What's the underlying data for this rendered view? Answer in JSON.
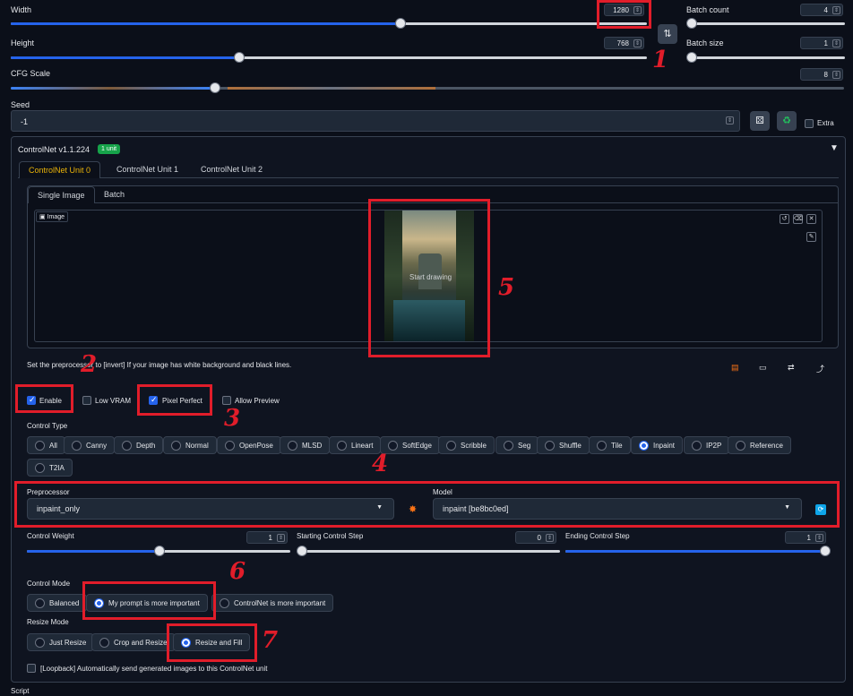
{
  "generation": {
    "width": {
      "label": "Width",
      "value": "1280"
    },
    "height": {
      "label": "Height",
      "value": "768"
    },
    "swap_icon": "swap-arrows-icon",
    "batch_count": {
      "label": "Batch count",
      "value": "4"
    },
    "batch_size": {
      "label": "Batch size",
      "value": "1"
    },
    "cfg_scale": {
      "label": "CFG Scale",
      "value": "8"
    },
    "seed": {
      "label": "Seed",
      "value": "-1",
      "extra_label": "Extra"
    }
  },
  "controlnet": {
    "title": "ControlNet v1.1.224",
    "badge": "1 unit",
    "collapse_glyph": "▼",
    "unit_tabs": [
      "ControlNet Unit 0",
      "ControlNet Unit 1",
      "ControlNet Unit 2"
    ],
    "image_tabs": [
      "Single Image",
      "Batch"
    ],
    "image_label": "Image",
    "image_overlay_text": "Start drawing",
    "hint_text": "Set the preprocessor to [invert] If your image has white background and black lines.",
    "checkboxes": [
      {
        "label": "Enable",
        "checked": true
      },
      {
        "label": "Low VRAM",
        "checked": false
      },
      {
        "label": "Pixel Perfect",
        "checked": true
      },
      {
        "label": "Allow Preview",
        "checked": false
      }
    ],
    "control_type_label": "Control Type",
    "control_types": [
      "All",
      "Canny",
      "Depth",
      "Normal",
      "OpenPose",
      "MLSD",
      "Lineart",
      "SoftEdge",
      "Scribble",
      "Seg",
      "Shuffle",
      "Tile",
      "Inpaint",
      "IP2P",
      "Reference",
      "T2IA"
    ],
    "control_type_selected": "Inpaint",
    "preprocessor": {
      "label": "Preprocessor",
      "value": "inpaint_only"
    },
    "model": {
      "label": "Model",
      "value": "inpaint [be8bc0ed]"
    },
    "control_weight": {
      "label": "Control Weight",
      "value": "1",
      "fraction": 0.5
    },
    "starting_step": {
      "label": "Starting Control Step",
      "value": "0",
      "fraction": 0.0
    },
    "ending_step": {
      "label": "Ending Control Step",
      "value": "1",
      "fraction": 1.0
    },
    "control_mode": {
      "label": "Control Mode",
      "options": [
        "Balanced",
        "My prompt is more important",
        "ControlNet is more important"
      ],
      "selected": "My prompt is more important"
    },
    "resize_mode": {
      "label": "Resize Mode",
      "options": [
        "Just Resize",
        "Crop and Resize",
        "Resize and Fill"
      ],
      "selected": "Resize and Fill"
    },
    "loopback_label": "[Loopback] Automatically send generated images to this ControlNet unit"
  },
  "script_label": "Script",
  "annotations": [
    "1",
    "2",
    "3",
    "4",
    "5",
    "6",
    "7"
  ],
  "colors": {
    "accent": "#2563eb",
    "annotation": "#e11d2a",
    "badge": "#16a34a"
  }
}
